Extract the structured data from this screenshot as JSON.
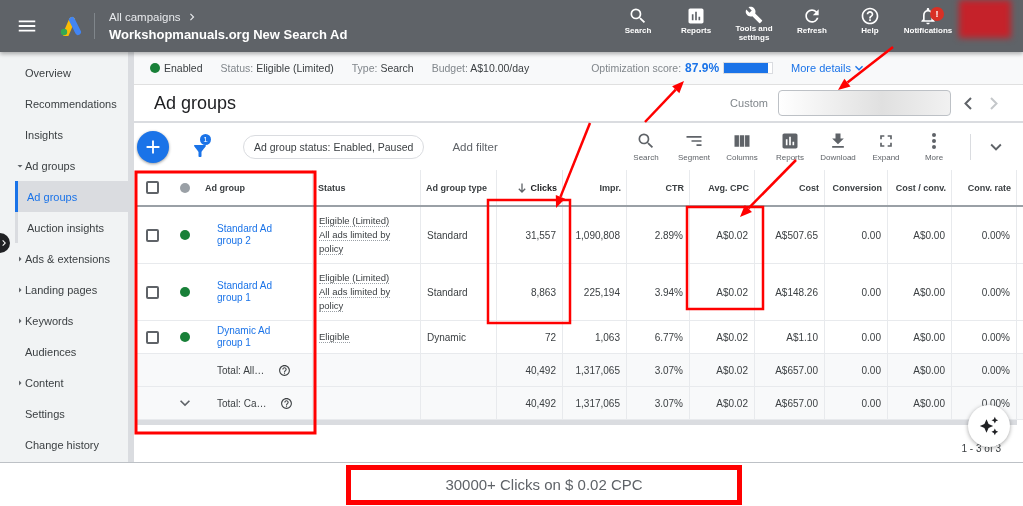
{
  "top_bar": {
    "breadcrumb": "All campaigns",
    "campaign": "Workshopmanuals.org New Search Ad",
    "actions": [
      {
        "label": "Search",
        "kind": "search"
      },
      {
        "label": "Reports",
        "kind": "reports"
      },
      {
        "label": "Tools and settings",
        "kind": "tools"
      },
      {
        "label": "Refresh",
        "kind": "refresh"
      },
      {
        "label": "Help",
        "kind": "help"
      },
      {
        "label": "Notifications",
        "kind": "notifications",
        "badge": "!"
      }
    ]
  },
  "sidebar": {
    "items": [
      {
        "label": "Overview",
        "selected": false
      },
      {
        "label": "Recommendations",
        "selected": false
      },
      {
        "label": "Insights",
        "selected": false
      },
      {
        "label": "Ad groups",
        "selected": false,
        "expanded": true,
        "children": [
          {
            "label": "Ad groups",
            "selected": true
          },
          {
            "label": "Auction insights",
            "selected": false
          }
        ]
      },
      {
        "label": "Ads & extensions",
        "selected": false,
        "expanded": false
      },
      {
        "label": "Landing pages",
        "selected": false,
        "expanded": false
      },
      {
        "label": "Keywords",
        "selected": false,
        "expanded": false
      },
      {
        "label": "Audiences",
        "selected": false
      },
      {
        "label": "Content",
        "selected": false,
        "expanded": false
      },
      {
        "label": "Settings",
        "selected": false
      },
      {
        "label": "Change history",
        "selected": false
      }
    ]
  },
  "summary": {
    "state": "Enabled",
    "facts": [
      {
        "label": "Status:",
        "value": "Eligible (Limited)"
      },
      {
        "label": "Type:",
        "value": "Search"
      },
      {
        "label": "Budget:",
        "value": "A$10.00/day"
      }
    ],
    "optimization": {
      "label": "Optimization score:",
      "value": "87.9%",
      "level": 0.92
    },
    "more_details": "More details"
  },
  "header": {
    "title": "Ad groups",
    "date_label": "Custom"
  },
  "toolbar": {
    "filter_count": "1",
    "filter_chip": "Ad group status: Enabled, Paused",
    "add_filter": "Add filter",
    "tools": [
      {
        "label": "Search",
        "kind": "search"
      },
      {
        "label": "Segment",
        "kind": "segment"
      },
      {
        "label": "Columns",
        "kind": "columns"
      },
      {
        "label": "Reports",
        "kind": "reports"
      },
      {
        "label": "Download",
        "kind": "download"
      },
      {
        "label": "Expand",
        "kind": "expand"
      },
      {
        "label": "More",
        "kind": "more"
      }
    ]
  },
  "table": {
    "header_checked": false,
    "columns": [
      {
        "label": "Ad group",
        "sorted": false
      },
      {
        "label": "Status",
        "sorted": false
      },
      {
        "label": "Ad group type",
        "sorted": false
      },
      {
        "label": "Clicks",
        "sorted": true
      },
      {
        "label": "Impr.",
        "sorted": false
      },
      {
        "label": "CTR",
        "sorted": false
      },
      {
        "label": "Avg. CPC",
        "sorted": false
      },
      {
        "label": "Cost",
        "sorted": false
      },
      {
        "label": "Conversion",
        "sorted": false
      },
      {
        "label": "Cost / conv.",
        "sorted": false
      },
      {
        "label": "Conv. rate",
        "sorted": false
      }
    ],
    "rows": [
      {
        "kind": "ad_group",
        "checked": false,
        "color": "#188038",
        "name": "Standard Ad group 2",
        "status": "Eligible (Limited)",
        "status_detail": "All ads limited by policy",
        "type": "Standard",
        "metrics": [
          "31,557",
          "1,090,808",
          "2.89%",
          "A$0.02",
          "A$507.65",
          "0.00",
          "A$0.00",
          "0.00%"
        ]
      },
      {
        "kind": "ad_group",
        "checked": false,
        "color": "#188038",
        "name": "Standard Ad group 1",
        "status": "Eligible (Limited)",
        "status_detail": "All ads limited by policy",
        "type": "Standard",
        "metrics": [
          "8,863",
          "225,194",
          "3.94%",
          "A$0.02",
          "A$148.26",
          "0.00",
          "A$0.00",
          "0.00%"
        ]
      },
      {
        "kind": "ad_group",
        "checked": false,
        "color": "#188038",
        "name": "Dynamic Ad group 1",
        "status": "Eligible",
        "type": "Dynamic",
        "metrics": [
          "72",
          "1,063",
          "6.77%",
          "A$0.02",
          "A$1.10",
          "0.00",
          "A$0.00",
          "0.00%"
        ]
      },
      {
        "kind": "total",
        "label": "Total: All…",
        "metrics": [
          "40,492",
          "1,317,065",
          "3.07%",
          "A$0.02",
          "A$657.00",
          "0.00",
          "A$0.00",
          "0.00%"
        ]
      },
      {
        "kind": "total",
        "label": "Total: Ca…",
        "expanded": false,
        "metrics": [
          "40,492",
          "1,317,065",
          "3.07%",
          "A$0.02",
          "A$657.00",
          "0.00",
          "A$0.00",
          "0.00%"
        ]
      }
    ],
    "pagination": "1 - 3 of 3"
  },
  "caption": "30000+ Clicks on $ 0.02 CPC"
}
